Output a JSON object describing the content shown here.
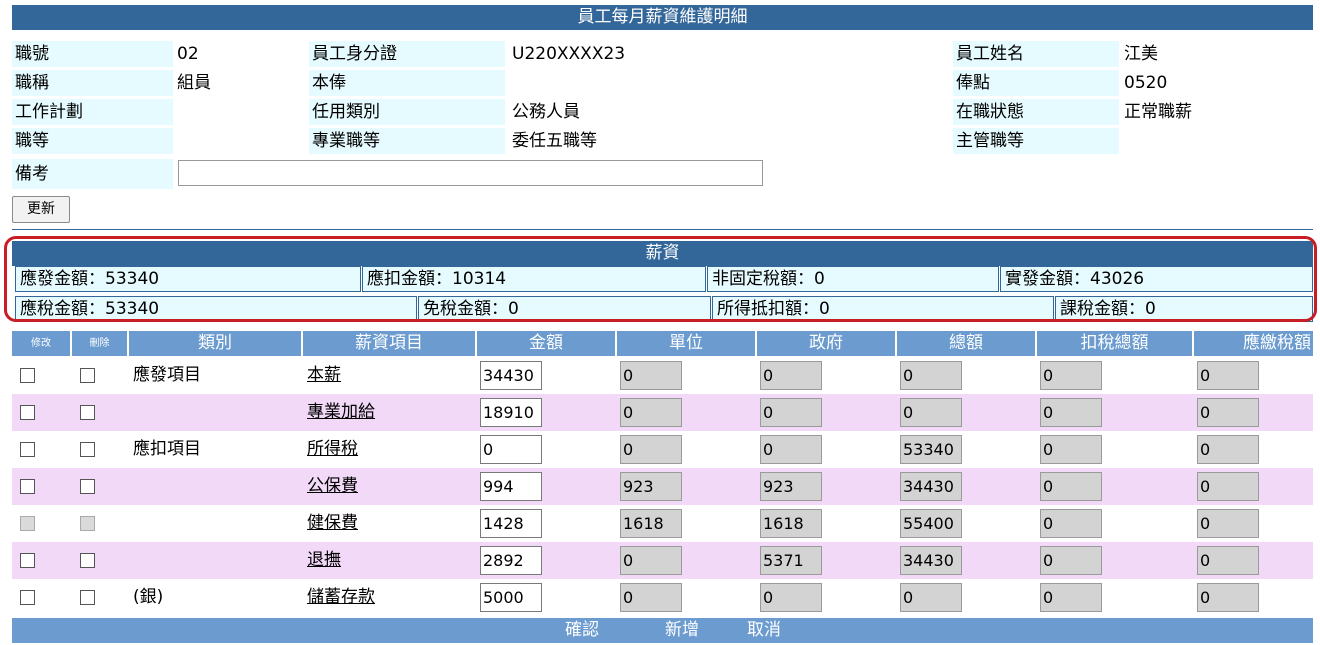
{
  "page_title": "員工每月薪資維護明細",
  "info": {
    "emp_no_label": "職號",
    "emp_no": "02",
    "id_label": "員工身分證",
    "id": "U220XXXX23",
    "name_label": "員工姓名",
    "name": "江美",
    "title_label": "職稱",
    "title": "組員",
    "base_pay_label": "本俸",
    "pay_point_label": "俸點",
    "pay_point": "0520",
    "work_plan_label": "工作計劃",
    "appoint_type_label": "任用類別",
    "appoint_type": "公務人員",
    "status_label": "在職狀態",
    "status": "正常職薪",
    "grade_label": "職等",
    "prof_grade_label": "專業職等",
    "prof_grade": "委任五職等",
    "mgr_grade_label": "主管職等",
    "remark_label": "備考",
    "remark": "",
    "update_button": "更新"
  },
  "salary": {
    "title": "薪資",
    "payable": "應發金額：53340",
    "deduction": "應扣金額：10314",
    "non_fixed_tax": "非固定稅額：0",
    "actual": "實發金額：43026",
    "taxable": "應稅金額：53340",
    "tax_free": "免稅金額：0",
    "income_deduct": "所得抵扣額：0",
    "tax_amount": "課稅金額：0"
  },
  "table": {
    "headers": {
      "edit": "修改",
      "delete": "刪除",
      "category": "類別",
      "item": "薪資項目",
      "amount": "金額",
      "unit": "單位",
      "gov": "政府",
      "total": "總額",
      "tax_total": "扣稅總額",
      "tax_due": "應繳稅額"
    },
    "rows": [
      {
        "category": "應發項目",
        "item": "本薪",
        "amount": "34430",
        "unit": "0",
        "gov": "0",
        "total": "0",
        "tax_total": "0",
        "tax_due": "0"
      },
      {
        "category": "",
        "item": "專業加給",
        "amount": "18910",
        "unit": "0",
        "gov": "0",
        "total": "0",
        "tax_total": "0",
        "tax_due": "0"
      },
      {
        "category": "應扣項目",
        "item": "所得稅",
        "amount": "0",
        "unit": "0",
        "gov": "0",
        "total": "53340",
        "tax_total": "0",
        "tax_due": "0"
      },
      {
        "category": "",
        "item": "公保費",
        "amount": "994",
        "unit": "923",
        "gov": "923",
        "total": "34430",
        "tax_total": "0",
        "tax_due": "0"
      },
      {
        "category": "",
        "item": "健保費",
        "amount": "1428",
        "unit": "1618",
        "gov": "1618",
        "total": "55400",
        "tax_total": "0",
        "tax_due": "0"
      },
      {
        "category": "",
        "item": "退撫",
        "amount": "2892",
        "unit": "0",
        "gov": "5371",
        "total": "34430",
        "tax_total": "0",
        "tax_due": "0"
      },
      {
        "category": "(銀)",
        "item": "儲蓄存款",
        "amount": "5000",
        "unit": "0",
        "gov": "0",
        "total": "0",
        "tax_total": "0",
        "tax_due": "0"
      }
    ]
  },
  "footer": {
    "confirm": "確認",
    "add": "新增",
    "cancel": "取消"
  }
}
